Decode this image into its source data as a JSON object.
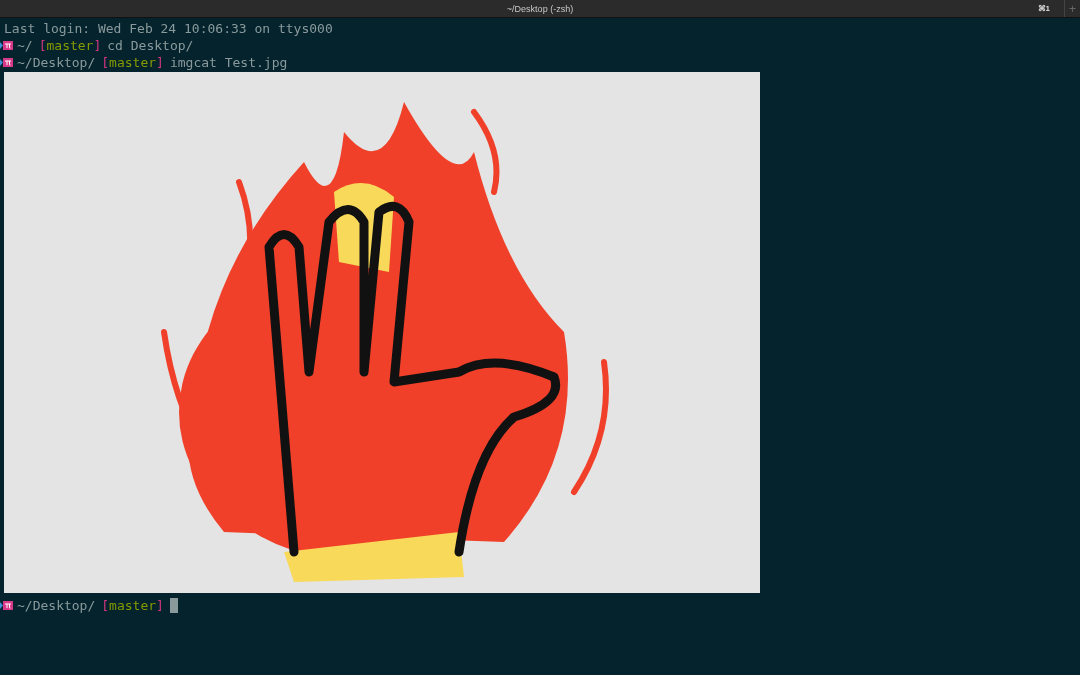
{
  "window": {
    "title": "~/Desktop (-zsh)",
    "tab_shortcut": "⌘1",
    "new_tab": "+"
  },
  "lines": [
    {
      "kind": "text",
      "text": "Last login: Wed Feb 24 10:06:33 on ttys000"
    },
    {
      "kind": "prompt",
      "path": "~/",
      "branch": "[master]",
      "command": "cd Desktop/"
    },
    {
      "kind": "prompt",
      "path": "~/Desktop/",
      "branch": "[master]",
      "command": "imgcat Test.jpg"
    },
    {
      "kind": "image"
    },
    {
      "kind": "prompt",
      "path": "~/Desktop/",
      "branch": "[master]",
      "cursor": true
    }
  ]
}
